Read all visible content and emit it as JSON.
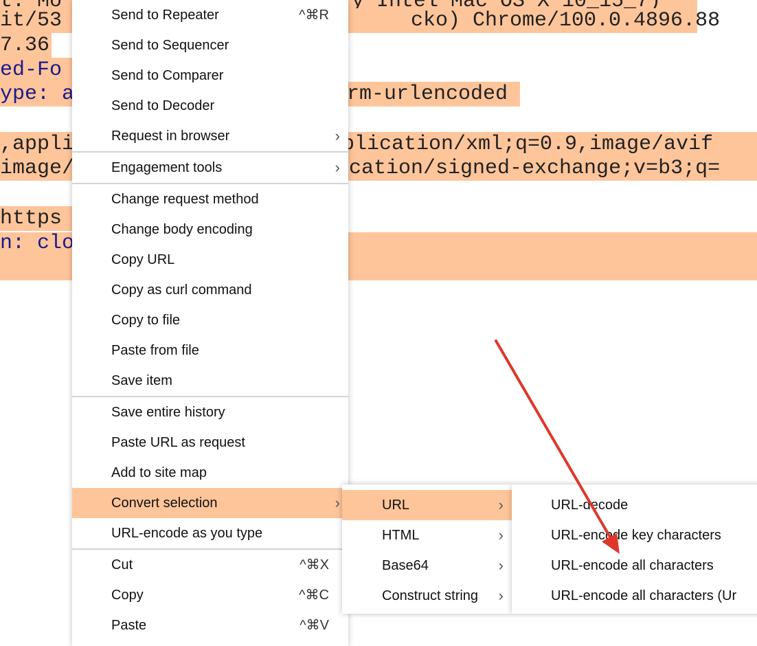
{
  "background": {
    "lines": [
      {
        "left": "t: Mo",
        "right": "y Intel Mac OS X 10_15_7)"
      },
      {
        "left": "it/53",
        "right": "cko) Chrome/100.0.4896.88"
      },
      {
        "left": "7.36"
      },
      {
        "left": "ed-Fo"
      },
      {
        "left": "ype: a",
        "right": "rm-urlencoded"
      },
      {
        "left": ",appli",
        "right": "plication/xml;q=0.9,image/avif"
      },
      {
        "left": "image/",
        "right": "ication/signed-exchange;v=b3;q="
      },
      {
        "left": "https"
      },
      {
        "left": "n: clo"
      }
    ]
  },
  "menu": {
    "items": [
      {
        "label": "Send to Repeater",
        "shortcut": "^⌘R"
      },
      {
        "label": "Send to Sequencer"
      },
      {
        "label": "Send to Comparer"
      },
      {
        "label": "Send to Decoder"
      },
      {
        "label": "Request in browser",
        "submenu": true
      },
      {
        "label": "Engagement tools",
        "submenu": true
      },
      {
        "label": "Change request method"
      },
      {
        "label": "Change body encoding"
      },
      {
        "label": "Copy URL"
      },
      {
        "label": "Copy as curl command"
      },
      {
        "label": "Copy to file"
      },
      {
        "label": "Paste from file"
      },
      {
        "label": "Save item"
      },
      {
        "label": "Save entire history"
      },
      {
        "label": "Paste URL as request"
      },
      {
        "label": "Add to site map"
      },
      {
        "label": "Convert selection",
        "submenu": true,
        "highlighted": true
      },
      {
        "label": "URL-encode as you type"
      },
      {
        "label": "Cut",
        "shortcut": "^⌘X"
      },
      {
        "label": "Copy",
        "shortcut": "^⌘C"
      },
      {
        "label": "Paste",
        "shortcut": "^⌘V"
      }
    ]
  },
  "submenu1": {
    "items": [
      {
        "label": "URL",
        "highlighted": true
      },
      {
        "label": "HTML"
      },
      {
        "label": "Base64"
      },
      {
        "label": "Construct string"
      }
    ]
  },
  "submenu2": {
    "items": [
      {
        "label": "URL-decode"
      },
      {
        "label": "URL-encode key characters"
      },
      {
        "label": "URL-encode all characters"
      },
      {
        "label": "URL-encode all characters (Ur"
      }
    ]
  },
  "colors": {
    "highlight": "#fec59a",
    "arrow": "#e0362a"
  }
}
